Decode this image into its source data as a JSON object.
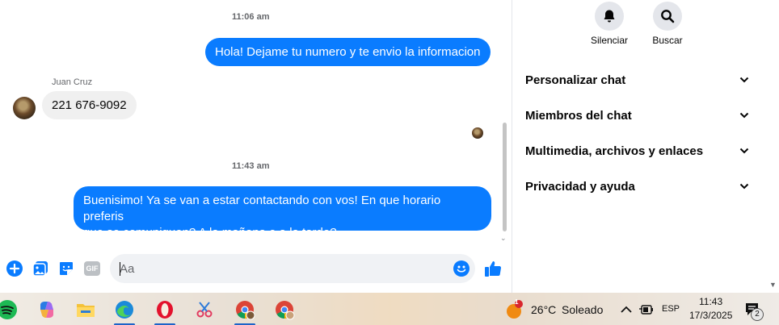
{
  "chat": {
    "timestamp_1": "11:06 am",
    "message_out_1": "Hola! Dejame tu numero y te envio la informacion",
    "sender_name": "Juan Cruz",
    "message_in_1": "221 676-9092",
    "timestamp_2": "11:43 am",
    "message_out_2_line1": "Buenisimo! Ya se van a estar contactando con vos! En que horario preferis",
    "message_out_2_line2": "que se comuniquen? A la mañana o a la tarde?"
  },
  "composer": {
    "placeholder": "Aa",
    "gif_label": "GIF"
  },
  "panel": {
    "mute_label": "Silenciar",
    "search_label": "Buscar",
    "sections": [
      {
        "label": "Personalizar chat"
      },
      {
        "label": "Miembros del chat"
      },
      {
        "label": "Multimedia, archivos y enlaces"
      },
      {
        "label": "Privacidad y ayuda"
      }
    ]
  },
  "taskbar": {
    "apps": [
      "spotify-icon",
      "copilot-icon",
      "file-explorer-icon",
      "edge-icon",
      "opera-icon",
      "snipping-tool-icon",
      "chrome-profile-icon",
      "chrome-icon"
    ],
    "weather_badge": "1",
    "temperature": "26°C",
    "weather_text": "Soleado",
    "language": "ESP",
    "time": "11:43",
    "date": "17/3/2025",
    "notification_count": "2"
  },
  "colors": {
    "messenger_blue": "#0a7cff",
    "incoming_bubble": "#f0f0f0",
    "panel_button": "#e4e6eb"
  }
}
